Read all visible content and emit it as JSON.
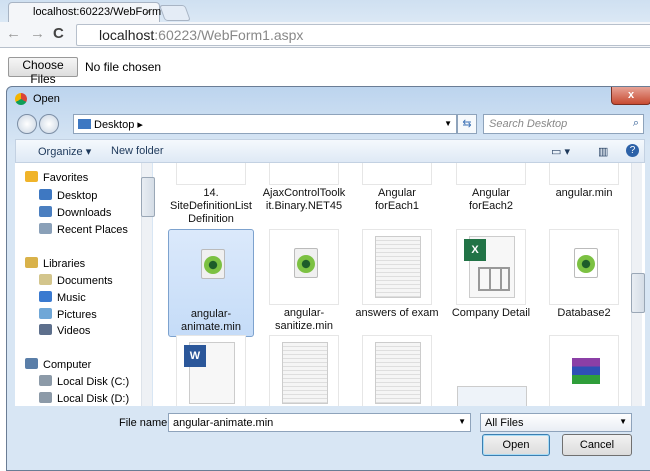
{
  "browser": {
    "tab_title": "localhost:60223/WebForm",
    "url_host": "localhost",
    "url_rest": ":60223/WebForm1.aspx"
  },
  "page": {
    "choose_button": "Choose Files",
    "file_status": "No file chosen"
  },
  "dialog": {
    "title": "Open",
    "close": "x",
    "location": "Desktop",
    "search_placeholder": "Search Desktop",
    "toolbar": {
      "organize": "Organize ▾",
      "new_folder": "New folder"
    },
    "nav": [
      {
        "label": "Favorites",
        "color": "#f0b42a"
      },
      {
        "label": "Desktop",
        "color": "#3e78c2"
      },
      {
        "label": "Downloads",
        "color": "#4b7fc0"
      },
      {
        "label": "Recent Places",
        "color": "#8aa0b8"
      },
      {
        "label": "Libraries",
        "color": "#d9b24a"
      },
      {
        "label": "Documents",
        "color": "#d3c58c"
      },
      {
        "label": "Music",
        "color": "#3a7ad0"
      },
      {
        "label": "Pictures",
        "color": "#6fa7d7"
      },
      {
        "label": "Videos",
        "color": "#5d6f8c"
      },
      {
        "label": "Computer",
        "color": "#5a7ea8"
      },
      {
        "label": "Local Disk (C:)",
        "color": "#8c9aa8"
      },
      {
        "label": "Local Disk (D:)",
        "color": "#8c9aa8"
      }
    ],
    "files": [
      {
        "name": "14. SiteDefinitionList Definition"
      },
      {
        "name": "AjaxControlToolkit.Binary.NET45"
      },
      {
        "name": "Angular forEach1"
      },
      {
        "name": "Angular forEach2"
      },
      {
        "name": "angular.min"
      },
      {
        "name": "angular-animate.min",
        "selected": true
      },
      {
        "name": "angular-sanitize.min"
      },
      {
        "name": "answers of exam"
      },
      {
        "name": "Company Detail"
      },
      {
        "name": "Database2"
      }
    ],
    "file_name_label": "File name:",
    "file_name_value": "angular-animate.min",
    "filter": "All Files",
    "open_button": "Open",
    "cancel_button": "Cancel"
  }
}
